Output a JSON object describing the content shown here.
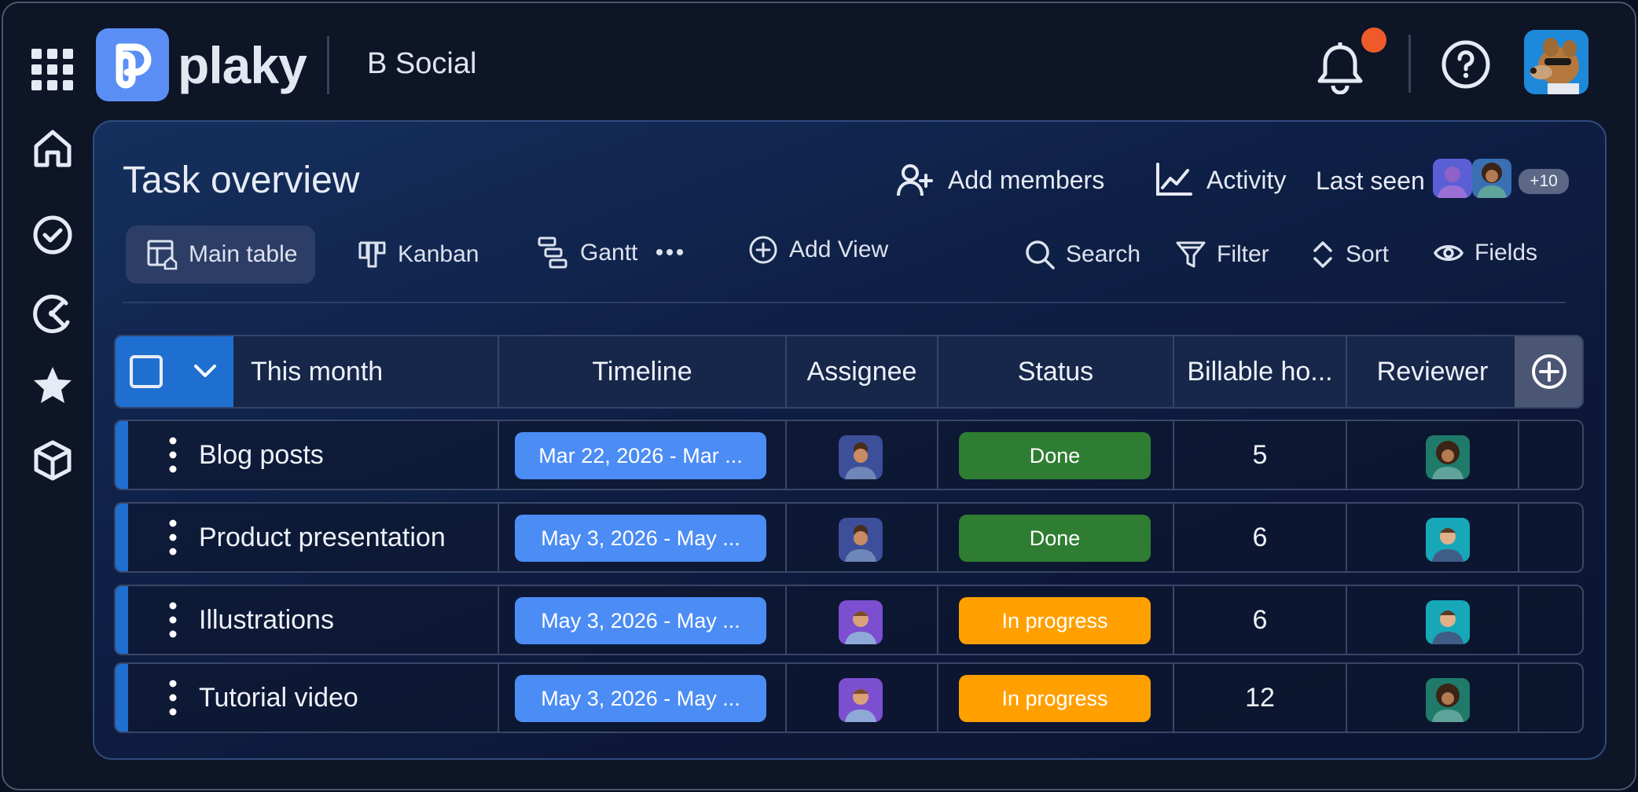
{
  "app": {
    "brand": "plaky",
    "workspace": "B Social"
  },
  "board": {
    "title": "Task overview",
    "add_members_label": "Add members",
    "activity_label": "Activity",
    "last_seen_label": "Last seen",
    "last_seen_more": "+10"
  },
  "views": {
    "main_table": "Main table",
    "kanban": "Kanban",
    "gantt": "Gantt",
    "add_view": "Add View"
  },
  "tools": {
    "search": "Search",
    "filter": "Filter",
    "sort": "Sort",
    "fields": "Fields"
  },
  "table": {
    "group_label": "This month",
    "columns": {
      "timeline": "Timeline",
      "assignee": "Assignee",
      "status": "Status",
      "billable": "Billable ho...",
      "reviewer": "Reviewer"
    },
    "rows": [
      {
        "name": "Blog posts",
        "timeline": "Mar 22, 2026 - Mar ...",
        "status": "Done",
        "hours": "5"
      },
      {
        "name": "Product presentation",
        "timeline": "May 3, 2026 - May ...",
        "status": "Done",
        "hours": "6"
      },
      {
        "name": "Illustrations",
        "timeline": "May 3, 2026 - May ...",
        "status": "In progress",
        "hours": "6"
      },
      {
        "name": "Tutorial video",
        "timeline": "May 3, 2026 - May ...",
        "status": "In progress",
        "hours": "12"
      }
    ]
  },
  "colors": {
    "accent": "#1f6fd1",
    "timeline_pill": "#4c8cf5",
    "status_done": "#2f7d32",
    "status_in_progress": "#ffa000",
    "notification_dot": "#ef5a2b"
  },
  "icons": {
    "sidebar": [
      "home-icon",
      "check-circle-icon",
      "time-tracking-icon",
      "star-icon",
      "cube-icon"
    ],
    "top": [
      "apps-grid-icon",
      "bell-icon",
      "help-icon"
    ]
  }
}
